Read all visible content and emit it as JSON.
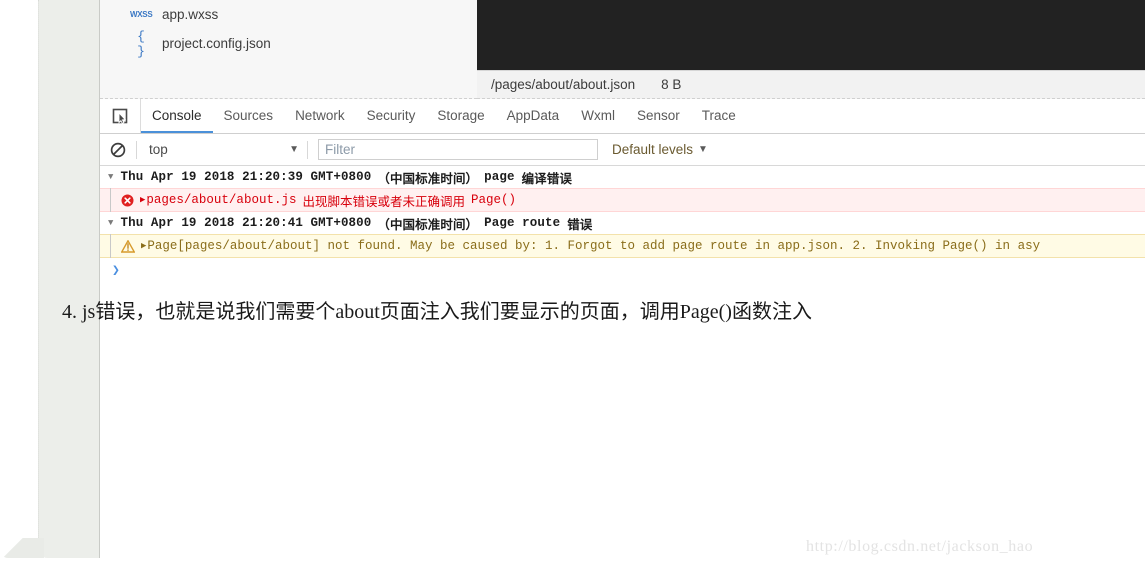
{
  "ide": {
    "files": [
      {
        "icon": "wxss-file-icon",
        "icon_glyph": "WXSS",
        "label": "app.wxss"
      },
      {
        "icon": "json-file-icon",
        "icon_glyph": "{ }",
        "label": "project.config.json"
      }
    ],
    "path_bar": {
      "path": "/pages/about/about.json",
      "size": "8 B"
    },
    "devtools": {
      "inspect_icon": "inspect-element-icon",
      "tabs": [
        {
          "label": "Console",
          "active": true
        },
        {
          "label": "Sources",
          "active": false
        },
        {
          "label": "Network",
          "active": false
        },
        {
          "label": "Security",
          "active": false
        },
        {
          "label": "Storage",
          "active": false
        },
        {
          "label": "AppData",
          "active": false
        },
        {
          "label": "Wxml",
          "active": false
        },
        {
          "label": "Sensor",
          "active": false
        },
        {
          "label": "Trace",
          "active": false
        }
      ],
      "active_tab_underline_color": "#4a90d9"
    },
    "console_toolbar": {
      "clear_icon": "clear-console-icon",
      "context_value": "top",
      "context_caret": "▼",
      "filter_value": "",
      "filter_placeholder": "Filter",
      "levels_label": "Default levels",
      "levels_caret": "▼"
    },
    "console_log": {
      "entries": [
        {
          "type": "group",
          "triangle": "▼",
          "timestamp": "Thu Apr 19 2018 21:20:39 GMT+0800",
          "tz": "（中国标准时间）",
          "tag": "page",
          "suffix": "编译错误"
        },
        {
          "type": "error",
          "severity_icon": "error-circle-icon",
          "expander": "▶",
          "text_mono": "pages/about/about.js",
          "text_cjk": "出现脚本错误或者未正确调用",
          "text_tail": "Page()",
          "color": "#d8000c",
          "background": "#fff0f0"
        },
        {
          "type": "group",
          "triangle": "▼",
          "timestamp": "Thu Apr 19 2018 21:20:41 GMT+0800",
          "tz": "（中国标准时间）",
          "tag": "Page route",
          "suffix": "错误"
        },
        {
          "type": "warning",
          "severity_icon": "warning-triangle-icon",
          "expander": "▶",
          "text_mono": "Page[pages/about/about] not found. May be caused by: 1. Forgot to add page route in app.json. 2. Invoking Page() in asy",
          "color": "#8a6d1a",
          "background": "#fffbe5"
        }
      ],
      "prompt": "❯"
    }
  },
  "article": {
    "paragraph": "4. js错误，也就是说我们需要个about页面注入我们要显示的页面，调用Page()函数注入"
  },
  "watermark": {
    "text": "http://blog.csdn.net/jackson_hao"
  }
}
